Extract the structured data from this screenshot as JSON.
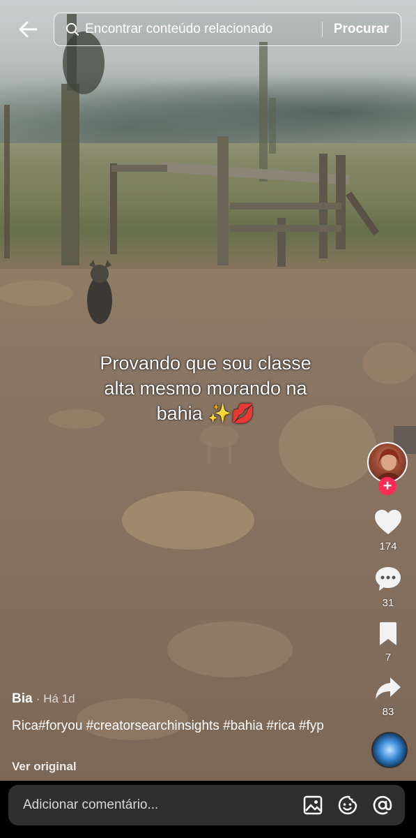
{
  "search": {
    "placeholder": "Encontrar conteúdo relacionado",
    "button_label": "Procurar"
  },
  "video": {
    "overlay_text_line1": "Provando que sou classe",
    "overlay_text_line2": "alta mesmo morando na",
    "overlay_text_line3": "bahia ✨💋"
  },
  "rail": {
    "likes": "174",
    "comments": "31",
    "saves": "7",
    "shares": "83",
    "follow_symbol": "+"
  },
  "post": {
    "author": "Bia",
    "time": "Há 1d",
    "description": "Rica#foryou #creatorsearchinsights #bahia #rica #fyp",
    "see_original": "Ver original"
  },
  "comment_bar": {
    "placeholder": "Adicionar comentário..."
  },
  "icons": {
    "back": "arrow-left-icon",
    "search": "search-icon",
    "like": "heart-icon",
    "comment": "comment-bubble-icon",
    "save": "bookmark-icon",
    "share": "share-arrow-icon",
    "image": "image-icon",
    "emoji": "emoji-icon",
    "mention": "at-icon"
  },
  "colors": {
    "follow_badge": "#fe2c55",
    "comment_box": "#2f2f2f"
  }
}
